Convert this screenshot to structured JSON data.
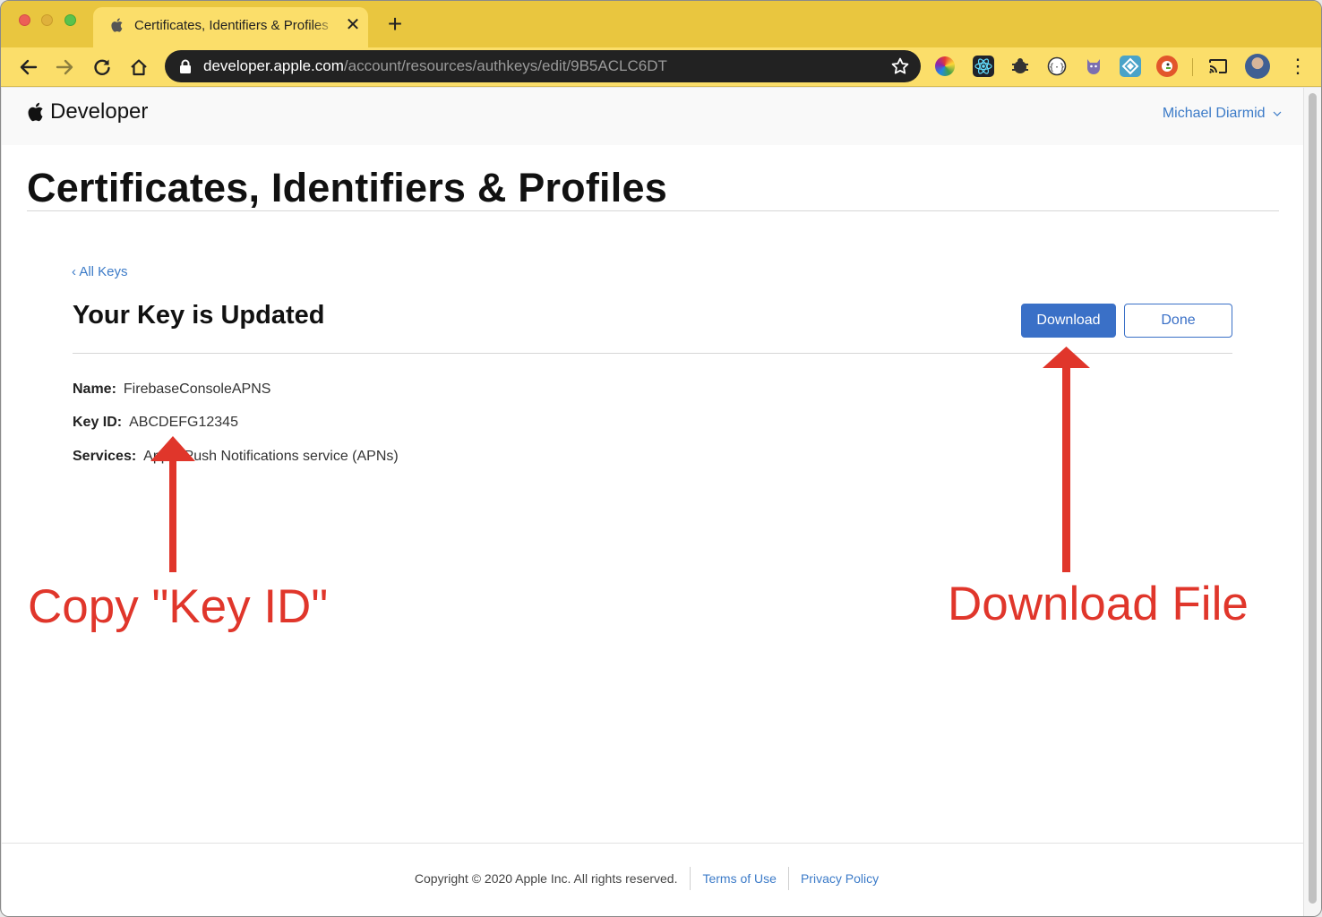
{
  "browser": {
    "tab_title": "Certificates, Identifiers & Profiles",
    "url_host": "developer.apple.com",
    "url_path": "/account/resources/authkeys/edit/9B5ACLC6DT",
    "tab_close": "✕",
    "new_tab": "+",
    "menu": "⋮"
  },
  "header": {
    "brand": "Developer",
    "account_name": "Michael Diarmid"
  },
  "page": {
    "title": "Certificates, Identifiers & Profiles",
    "back_link": "‹ All Keys",
    "card_title": "Your Key is Updated",
    "download_label": "Download",
    "done_label": "Done"
  },
  "details": {
    "name_label": "Name:",
    "name_value": "FirebaseConsoleAPNS",
    "key_id_label": "Key ID:",
    "key_id_value": "ABCDEFG12345",
    "services_label": "Services:",
    "services_value": "Apple Push Notifications service (APNs)"
  },
  "footer": {
    "copyright": "Copyright © 2020 Apple Inc. All rights reserved.",
    "terms": "Terms of Use",
    "privacy": "Privacy Policy"
  },
  "annotations": {
    "copy_key_id": "Copy \"Key ID\"",
    "download_file": "Download File",
    "color": "#e0362b"
  },
  "icons": [
    "apple-icon",
    "back-arrow-icon",
    "forward-arrow-icon",
    "reload-icon",
    "home-icon",
    "lock-icon",
    "star-icon",
    "cast-icon",
    "chevron-down-icon"
  ],
  "colors": {
    "chrome_yellow": "#e9c63f",
    "toolbar_yellow": "#fbde6a",
    "accent_blue": "#3a70c7",
    "link_blue": "#3c7bc8"
  }
}
